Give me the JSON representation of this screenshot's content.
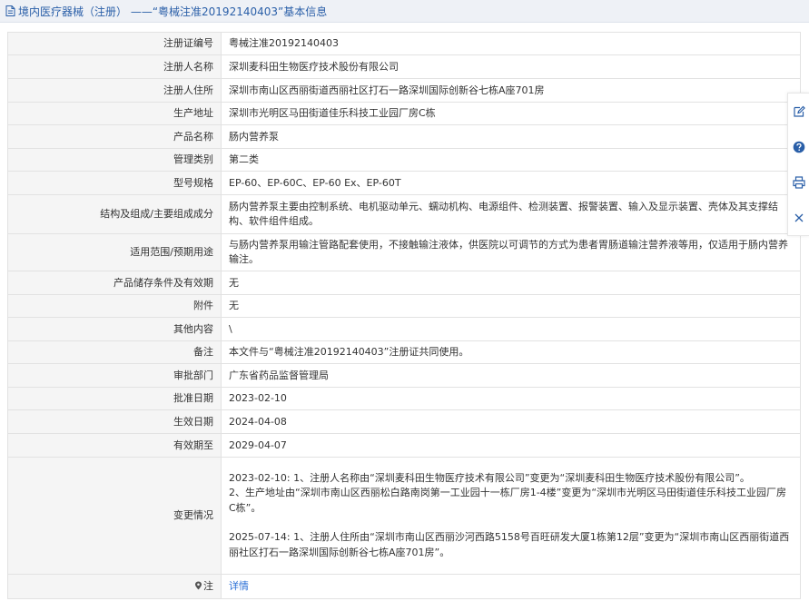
{
  "header": {
    "title": "境内医疗器械（注册） ——“粤械注准20192140403”基本信息"
  },
  "rows": [
    {
      "label": "注册证编号",
      "value": "粤械注准20192140403"
    },
    {
      "label": "注册人名称",
      "value": "深圳麦科田生物医疗技术股份有限公司"
    },
    {
      "label": "注册人住所",
      "value": "深圳市南山区西丽街道西丽社区打石一路深圳国际创新谷七栋A座701房"
    },
    {
      "label": "生产地址",
      "value": "深圳市光明区马田街道佳乐科技工业园厂房C栋"
    },
    {
      "label": "产品名称",
      "value": "肠内营养泵"
    },
    {
      "label": "管理类别",
      "value": "第二类"
    },
    {
      "label": "型号规格",
      "value": "EP-60、EP-60C、EP-60 Ex、EP-60T"
    },
    {
      "label": "结构及组成/主要组成成分",
      "value": "肠内营养泵主要由控制系统、电机驱动单元、蠕动机构、电源组件、检测装置、报警装置、输入及显示装置、壳体及其支撑结构、软件组件组成。"
    },
    {
      "label": "适用范围/预期用途",
      "value": "与肠内营养泵用输注管路配套使用，不接触输注液体，供医院以可调节的方式为患者胃肠道输注营养液等用，仅适用于肠内营养输注。"
    },
    {
      "label": "产品储存条件及有效期",
      "value": "无"
    },
    {
      "label": "附件",
      "value": "无"
    },
    {
      "label": "其他内容",
      "value": "\\"
    },
    {
      "label": "备注",
      "value": "本文件与“粤械注准20192140403”注册证共同使用。"
    },
    {
      "label": "审批部门",
      "value": "广东省药品监督管理局"
    },
    {
      "label": "批准日期",
      "value": "2023-02-10"
    },
    {
      "label": "生效日期",
      "value": "2024-04-08"
    },
    {
      "label": "有效期至",
      "value": "2029-04-07"
    }
  ],
  "changes": {
    "label": "变更情况",
    "entry1_line1": "2023-02-10: 1、注册人名称由“深圳麦科田生物医疗技术有限公司”变更为“深圳麦科田生物医疗技术股份有限公司”。",
    "entry1_line2": "2、生产地址由“深圳市南山区西丽松白路南岗第一工业园十一栋厂房1-4楼”变更为“深圳市光明区马田街道佳乐科技工业园厂房C栋”。",
    "entry2": "2025-07-14: 1、注册人住所由“深圳市南山区西丽沙河西路5158号百旺研发大厦1栋第12层”变更为“深圳市南山区西丽街道西丽社区打石一路深圳国际创新谷七栋A座701房”。"
  },
  "note": {
    "label": "注",
    "link": "详情"
  },
  "colors": {
    "accent": "#2a5fa8",
    "link": "#2a6fd6",
    "label_bg": "#f5f5f5",
    "border": "#e2e2e2"
  },
  "tools": [
    "edit-icon",
    "help-icon",
    "print-icon",
    "close-icon"
  ]
}
